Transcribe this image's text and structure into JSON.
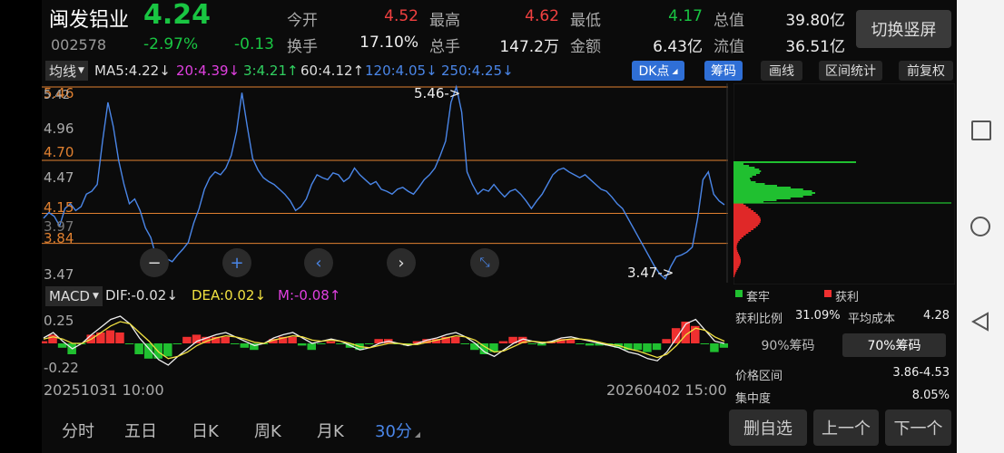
{
  "stock": {
    "name": "闽发铝业",
    "price": "4.24",
    "code": "002578",
    "change_pct": "-2.97%",
    "change": "-0.13"
  },
  "quote": {
    "open_label": "今开",
    "open": "4.52",
    "high_label": "最高",
    "high": "4.62",
    "low_label": "最低",
    "low": "4.17",
    "mktcap_label": "总值",
    "mktcap": "39.80亿",
    "turnover_label": "换手",
    "turnover": "17.10%",
    "volume_label": "总手",
    "volume": "147.2万",
    "amount_label": "金额",
    "amount": "6.43亿",
    "float_label": "流值",
    "float": "36.51亿"
  },
  "switch_button": "切换竖屏",
  "ma_bar": {
    "type": "均线",
    "ma5": "MA5:4.22",
    "ma20": "20:4.39",
    "ma3": "3:4.21",
    "ma60": "60:4.12",
    "ma120": "120:4.05",
    "ma250": "250:4.25",
    "colors": {
      "ma5": "#dddddd",
      "ma20": "#e040e0",
      "ma3": "#30d060",
      "ma60": "#dddddd",
      "ma120": "#4a86e8",
      "ma250": "#4a86e8"
    }
  },
  "tool_buttons": {
    "dk": "DK点",
    "chips": "筹码",
    "draw": "画线",
    "range": "区间统计",
    "adjust": "前复权"
  },
  "price_axis": {
    "top": "5.46",
    "top2": "5.42",
    "l1": "4.96",
    "l2": "4.70",
    "l3": "4.47",
    "l4": "4.15",
    "l5": "3.97",
    "l6": "3.84",
    "bottom": "3.47"
  },
  "annotations": {
    "high_mark": "5.46->",
    "low_mark": "3.47->"
  },
  "chart_data": {
    "type": "line",
    "title": "",
    "xlabel": "",
    "ylabel": "",
    "ylim": [
      3.47,
      5.46
    ],
    "series": [
      {
        "values": [
          4.1,
          4.16,
          4.12,
          4.02,
          4.2,
          4.25,
          4.18,
          4.22,
          4.35,
          4.38,
          4.45,
          4.9,
          5.3,
          5.05,
          4.7,
          4.45,
          4.25,
          4.3,
          4.18,
          4.0,
          3.9,
          3.7,
          3.62,
          3.68,
          3.65,
          3.72,
          3.78,
          3.85,
          4.05,
          4.2,
          4.4,
          4.52,
          4.58,
          4.55,
          4.62,
          4.75,
          5.0,
          5.4,
          5.05,
          4.72,
          4.6,
          4.52,
          4.48,
          4.45,
          4.4,
          4.35,
          4.28,
          4.18,
          4.22,
          4.3,
          4.45,
          4.55,
          4.52,
          4.5,
          4.57,
          4.55,
          4.48,
          4.52,
          4.62,
          4.55,
          4.5,
          4.45,
          4.48,
          4.4,
          4.38,
          4.35,
          4.4,
          4.42,
          4.38,
          4.35,
          4.42,
          4.5,
          4.55,
          4.62,
          4.75,
          4.9,
          5.3,
          5.46,
          5.2,
          4.58,
          4.45,
          4.35,
          4.4,
          4.38,
          4.45,
          4.38,
          4.32,
          4.38,
          4.4,
          4.35,
          4.28,
          4.2,
          4.28,
          4.35,
          4.45,
          4.55,
          4.6,
          4.62,
          4.58,
          4.55,
          4.52,
          4.55,
          4.5,
          4.45,
          4.4,
          4.38,
          4.32,
          4.25,
          4.2,
          4.1,
          4.0,
          3.9,
          3.8,
          3.7,
          3.6,
          3.52,
          3.47,
          3.6,
          3.7,
          3.72,
          3.75,
          3.8,
          4.1,
          4.5,
          4.58,
          4.35,
          4.28,
          4.24
        ]
      }
    ],
    "price_lines": [
      {
        "value": 5.46,
        "color": "#e08030"
      },
      {
        "value": 4.7,
        "color": "#e08030"
      },
      {
        "value": 4.15,
        "color": "#e08030"
      },
      {
        "value": 3.84,
        "color": "#e08030"
      }
    ]
  },
  "macd": {
    "label": "MACD",
    "dif": "DIF:-0.02",
    "dea": "DEA:0.02",
    "m": "M:-0.08",
    "axis_top": "0.25",
    "axis_bottom": "-0.22",
    "dif_values": [
      0.05,
      0.1,
      0.02,
      -0.05,
      0.0,
      0.08,
      0.15,
      0.22,
      0.25,
      0.18,
      0.05,
      -0.05,
      -0.15,
      -0.2,
      -0.12,
      -0.05,
      0.02,
      0.05,
      0.08,
      0.1,
      0.06,
      0.02,
      -0.02,
      0.0,
      0.05,
      0.08,
      0.1,
      0.05,
      0.0,
      0.02,
      0.04,
      0.02,
      -0.02,
      -0.06,
      -0.04,
      0.0,
      0.02,
      0.0,
      -0.02,
      0.0,
      0.03,
      0.05,
      0.08,
      0.1,
      0.06,
      0.0,
      -0.08,
      -0.12,
      -0.06,
      0.0,
      0.04,
      0.02,
      0.0,
      0.02,
      0.05,
      0.06,
      0.04,
      0.02,
      0.0,
      -0.02,
      -0.04,
      -0.08,
      -0.1,
      -0.14,
      -0.16,
      -0.08,
      0.05,
      0.18,
      0.22,
      0.12,
      0.02,
      0.0
    ],
    "dea_values": [
      0.04,
      0.06,
      0.04,
      0.0,
      0.0,
      0.04,
      0.1,
      0.16,
      0.2,
      0.18,
      0.1,
      0.02,
      -0.08,
      -0.14,
      -0.12,
      -0.08,
      -0.02,
      0.02,
      0.05,
      0.07,
      0.06,
      0.04,
      0.01,
      0.0,
      0.03,
      0.05,
      0.07,
      0.06,
      0.03,
      0.02,
      0.03,
      0.02,
      0.0,
      -0.03,
      -0.04,
      -0.02,
      0.0,
      0.0,
      -0.01,
      -0.01,
      0.01,
      0.03,
      0.05,
      0.07,
      0.06,
      0.03,
      -0.03,
      -0.08,
      -0.07,
      -0.03,
      0.01,
      0.02,
      0.01,
      0.01,
      0.03,
      0.04,
      0.04,
      0.03,
      0.01,
      -0.01,
      -0.02,
      -0.05,
      -0.07,
      -0.1,
      -0.13,
      -0.1,
      -0.02,
      0.08,
      0.14,
      0.12,
      0.06,
      0.02
    ],
    "bar_colors": {
      "pos": "#f03030",
      "neg": "#20c030"
    }
  },
  "dates": {
    "start": "20251031 10:00",
    "end": "20260402 15:00"
  },
  "chips": {
    "legend_trap": "套牢",
    "legend_profit": "获利",
    "profit_ratio_label": "获利比例",
    "profit_ratio": "31.09%",
    "avg_cost_label": "平均成本",
    "avg_cost": "4.28",
    "tab_90": "90%筹码",
    "tab_70": "70%筹码",
    "range_label": "价格区间",
    "range": "3.86-4.53",
    "conc_label": "集中度",
    "conc": "8.05%"
  },
  "period_tabs": [
    "分时",
    "五日",
    "日K",
    "周K",
    "月K",
    "30分"
  ],
  "period_selected": "30分",
  "bottom_buttons": {
    "remove": "删自选",
    "prev": "上一个",
    "next": "下一个"
  },
  "nav_icons": [
    "square-icon",
    "circle-icon",
    "back-triangle-icon"
  ]
}
